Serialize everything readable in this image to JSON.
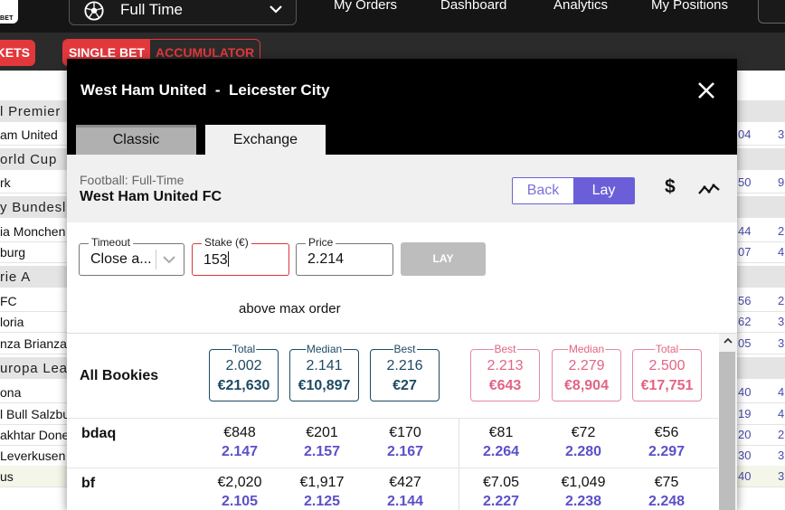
{
  "topbar": {
    "logo_text": "BET",
    "market_select": "Full Time",
    "nav": [
      "My Orders",
      "Dashboard",
      "Analytics",
      "My Positions"
    ]
  },
  "subbar": {
    "markets_pill": "KETS",
    "single_bet": "SINGLE BET",
    "accumulator": "ACCUMULATOR"
  },
  "background_list": [
    {
      "type": "league",
      "label": "l Premier",
      "v1": "",
      "v2": ""
    },
    {
      "type": "event",
      "label": "am United",
      "v1": "04",
      "v2": "3"
    },
    {
      "type": "league",
      "label": "orld Cup",
      "v1": "",
      "v2": ""
    },
    {
      "type": "event",
      "label": "rk",
      "v1": "50",
      "v2": "9"
    },
    {
      "type": "league",
      "label": "y Bundesl",
      "v1": "",
      "v2": ""
    },
    {
      "type": "event",
      "label": "ia Monchen",
      "v1": "44",
      "v2": "2"
    },
    {
      "type": "event",
      "label": "burg",
      "v1": "07",
      "v2": "4"
    },
    {
      "type": "league",
      "label": "rie A",
      "v1": "",
      "v2": ""
    },
    {
      "type": "event",
      "label": " FC",
      "v1": "56",
      "v2": "2"
    },
    {
      "type": "event",
      "label": "loria",
      "v1": "62",
      "v2": "3"
    },
    {
      "type": "event",
      "label": "nza Brianza",
      "v1": "05",
      "v2": "3"
    },
    {
      "type": "league",
      "label": "uropa Lea",
      "v1": "",
      "v2": ""
    },
    {
      "type": "event",
      "label": "ona",
      "v1": "40",
      "v2": "4"
    },
    {
      "type": "event",
      "label": "l Bull Salzbu",
      "v1": "19",
      "v2": "4"
    },
    {
      "type": "event",
      "label": "akhtar Donets",
      "v1": "20",
      "v2": "2"
    },
    {
      "type": "event",
      "label": "Leverkusen",
      "v1": "30",
      "v2": "3"
    },
    {
      "type": "event",
      "label": "us",
      "v1": "40",
      "v2": "3"
    }
  ],
  "modal": {
    "title": "West Ham United  -  Leicester City",
    "tabs": {
      "classic": "Classic",
      "exchange": "Exchange"
    },
    "selection": {
      "subtitle": "Football: Full-Time",
      "name": "West Ham United FC"
    },
    "toggle": {
      "back": "Back",
      "lay": "Lay"
    },
    "currency_symbol": "$",
    "form": {
      "timeout_label": "Timeout",
      "timeout_value": "Close a...",
      "stake_label": "Stake (€)",
      "stake_value": "153",
      "price_label": "Price",
      "price_value": "2.214",
      "lay_button": "LAY",
      "error": "above max order"
    },
    "all_bookies": {
      "label": "All Bookies",
      "back": [
        {
          "label": "Total",
          "price": "2.002",
          "amount": "€21,630"
        },
        {
          "label": "Median",
          "price": "2.141",
          "amount": "€10,897"
        },
        {
          "label": "Best",
          "price": "2.216",
          "amount": "€27"
        }
      ],
      "lay": [
        {
          "label": "Best",
          "price": "2.213",
          "amount": "€643"
        },
        {
          "label": "Median",
          "price": "2.279",
          "amount": "€8,904"
        },
        {
          "label": "Total",
          "price": "2.500",
          "amount": "€17,751"
        }
      ]
    },
    "bookies": [
      {
        "name": "bdaq",
        "back": [
          {
            "amt": "€848",
            "price": "2.147"
          },
          {
            "amt": "€201",
            "price": "2.157"
          },
          {
            "amt": "€170",
            "price": "2.167"
          }
        ],
        "lay": [
          {
            "amt": "€81",
            "price": "2.264"
          },
          {
            "amt": "€72",
            "price": "2.280"
          },
          {
            "amt": "€56",
            "price": "2.297"
          }
        ]
      },
      {
        "name": "bf",
        "back": [
          {
            "amt": "€2,020",
            "price": "2.105"
          },
          {
            "amt": "€1,917",
            "price": "2.125"
          },
          {
            "amt": "€427",
            "price": "2.144"
          }
        ],
        "lay": [
          {
            "amt": "€7.05",
            "price": "2.227"
          },
          {
            "amt": "€1,049",
            "price": "2.238"
          },
          {
            "amt": "€75",
            "price": "2.248"
          }
        ]
      }
    ]
  }
}
